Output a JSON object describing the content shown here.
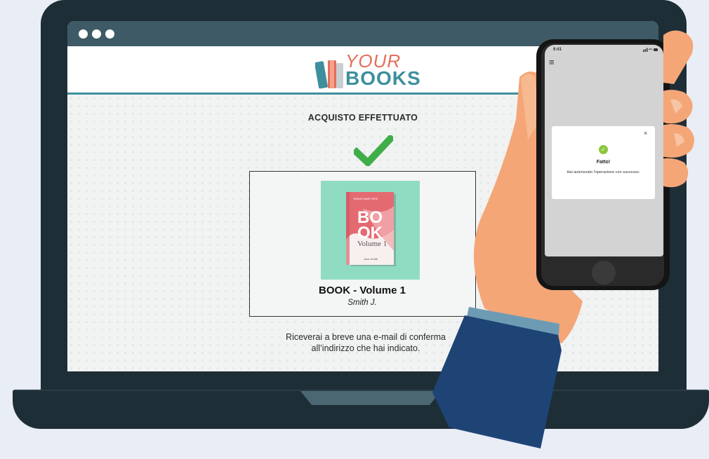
{
  "browser": {
    "dots": [
      "dot-1",
      "dot-2",
      "dot-3"
    ]
  },
  "site": {
    "logo_top": "YOUR",
    "logo_bottom": "BOOKS",
    "brand_colors": {
      "teal": "#3d8f9d",
      "coral": "#e2705a",
      "dark": "#1e2e36"
    }
  },
  "purchase": {
    "title": "ACQUISTO EFFETTUATO",
    "status_icon": "check-icon",
    "status_color": "#3fae49"
  },
  "product": {
    "cover": {
      "publisher": "BRAND NAME HERE",
      "title_line1": "BO",
      "title_line2": "OK",
      "subtitle": "Volume 1",
      "author": "Jane Smith"
    },
    "title": "BOOK - Volume 1",
    "author": "Smith J."
  },
  "confirmation": {
    "line1": "Riceverai a breve una e-mail di conferma",
    "line2": "all’indirizzo che hai indicato."
  },
  "phone": {
    "time": "9:41",
    "status_icons": "signal-wifi-battery-icon",
    "menu_icon": "hamburger-menu-icon",
    "modal": {
      "close": "×",
      "check": "✓",
      "title": "Fatto!",
      "message": "Hai autorizzato l'operazione con successo."
    }
  }
}
